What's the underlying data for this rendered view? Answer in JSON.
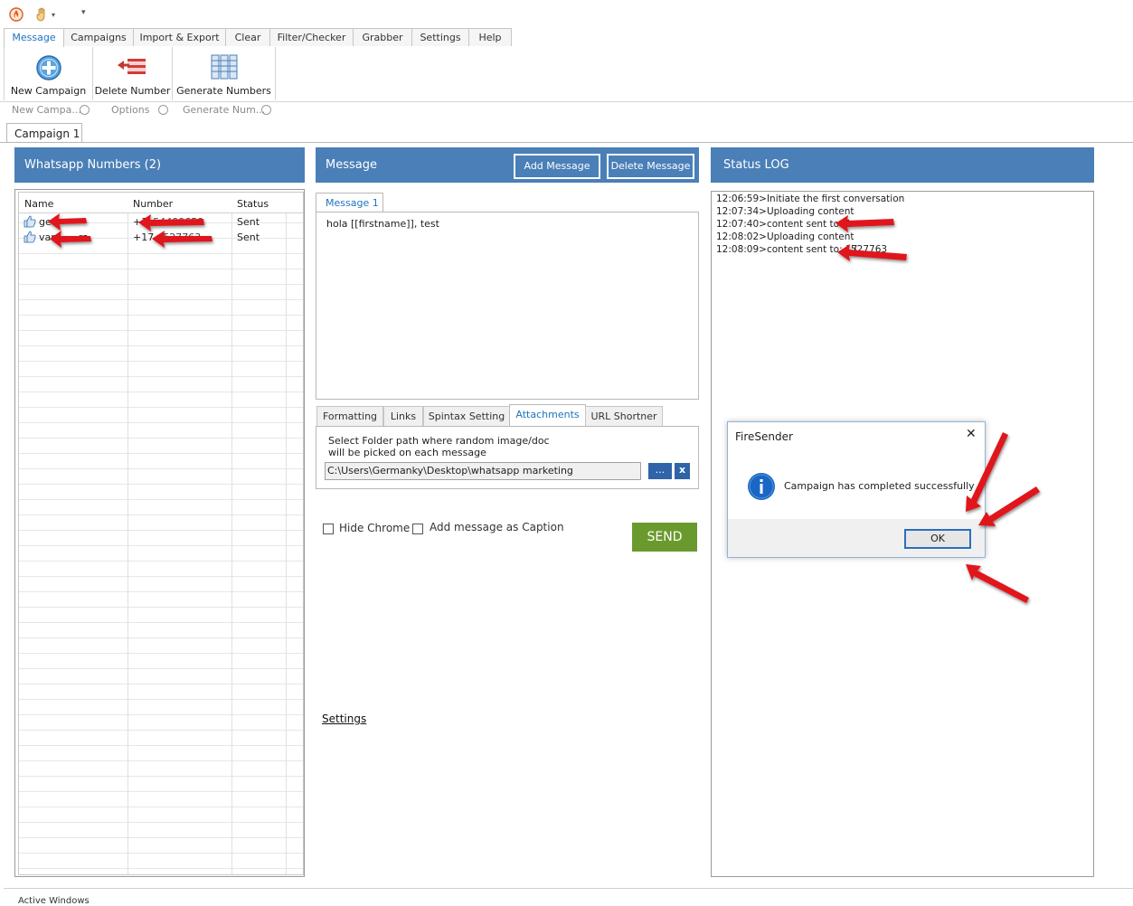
{
  "ribbon": {
    "tabs": [
      {
        "label": "Message",
        "active": true
      },
      {
        "label": "Campaigns"
      },
      {
        "label": "Import & Export"
      },
      {
        "label": "Clear"
      },
      {
        "label": "Filter/Checker"
      },
      {
        "label": "Grabber"
      },
      {
        "label": "Settings"
      },
      {
        "label": "Help"
      }
    ],
    "buttons": {
      "new_campaign": "New Campaign",
      "delete_number": "Delete Number",
      "generate_numbers": "Generate Numbers"
    },
    "groups": {
      "new_campaign": "New Campa...",
      "options": "Options",
      "generate_numbers": "Generate Num..."
    }
  },
  "campaign_tab": "Campaign 1",
  "numbers_panel": {
    "title": "Whatsapp Numbers (2)",
    "columns": {
      "name": "Name",
      "number": "Number",
      "status": "Status"
    },
    "rows": [
      {
        "name": "ge",
        "number": "+1",
        "number_tail": "54409659",
        "status": "Sent"
      },
      {
        "name": "var",
        "name_tail": "ra",
        "number": "+17",
        "number_tail": "527763",
        "status": "Sent"
      }
    ]
  },
  "message_panel": {
    "title": "Message",
    "add_message": "Add Message",
    "delete_message": "Delete Message",
    "message_tab": "Message 1",
    "message_text": "hola [[firstname]], test",
    "sub_tabs": [
      {
        "label": "Formatting"
      },
      {
        "label": "Links"
      },
      {
        "label": "Spintax Setting"
      },
      {
        "label": "Attachments",
        "active": true
      },
      {
        "label": "URL Shortner"
      }
    ],
    "attach_hint_1": "Select Folder path where random image/doc",
    "attach_hint_2": "will be picked on each message",
    "folder_path": "C:\\Users\\Germanky\\Desktop\\whatsapp marketing",
    "browse_label": "...",
    "clear_label": "x",
    "hide_chrome": "Hide Chrome",
    "add_caption": "Add message as Caption",
    "send": "SEND",
    "settings_link": "Settings"
  },
  "status_panel": {
    "title": "Status LOG",
    "lines": [
      "12:06:59>Initiate the first conversation",
      "12:07:34>Uploading content",
      "12:07:40>content sent to: 1",
      "12:08:02>Uploading content",
      "12:08:09>content sent to: 17",
      "527763"
    ]
  },
  "dialog": {
    "title": "FireSender",
    "message": "Campaign has completed successfully",
    "ok": "OK",
    "close": "✕"
  },
  "footer_text": "Active Windows",
  "colors": {
    "panel_header": "#4a7fb7",
    "accent": "#1e73be",
    "send": "#6a9a2e",
    "annotation": "#e0141b"
  }
}
